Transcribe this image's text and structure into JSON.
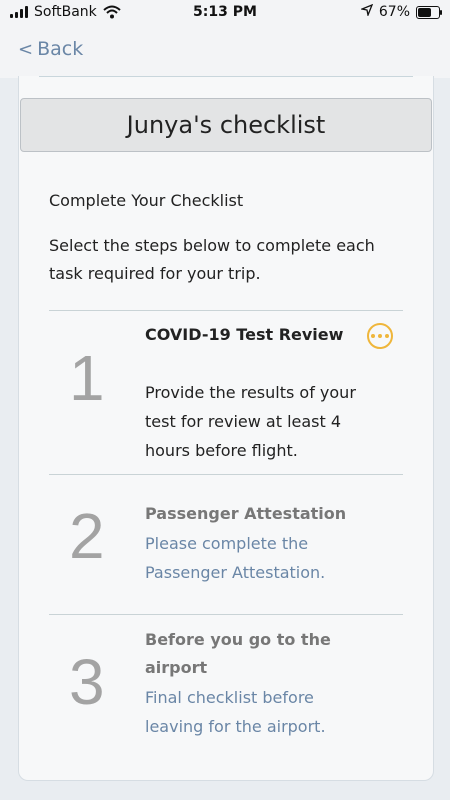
{
  "status_bar": {
    "carrier": "SoftBank",
    "time": "5:13 PM",
    "battery": "67%",
    "battery_level": 0.67
  },
  "nav": {
    "back_label": "Back"
  },
  "card": {
    "title": "Junya's checklist",
    "heading": "Complete Your Checklist",
    "description": "Select the steps below to complete each task required for your trip."
  },
  "steps": [
    {
      "number": "1",
      "title": "COVID-19 Test Review",
      "description": "Provide the results of your test for review at least 4 hours before flight.",
      "status_icon": "more-icon",
      "status_color": "#efb63b"
    },
    {
      "number": "2",
      "title": "Passenger Attestation",
      "description": "Please complete the Passenger Attestation."
    },
    {
      "number": "3",
      "title": "Before you go to the airport",
      "description": "Final checklist before leaving for the airport."
    }
  ],
  "colors": {
    "link": "#6a86a6",
    "accent": "#efb63b",
    "step_number": "#a3a3a3"
  }
}
